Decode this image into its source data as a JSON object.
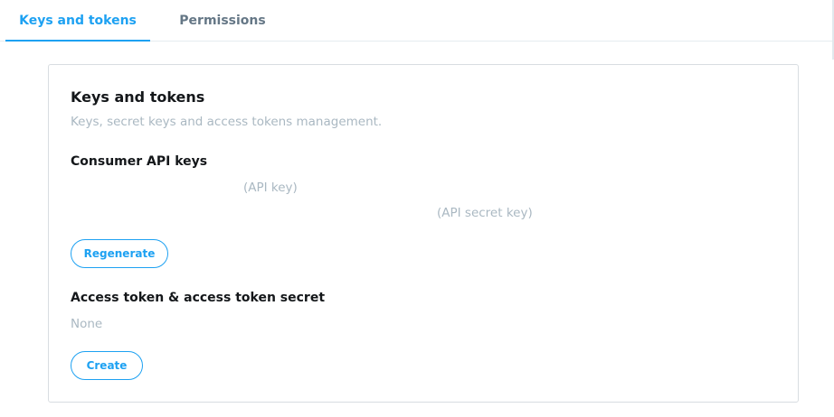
{
  "tabs": [
    {
      "label": "Keys and tokens",
      "active": true
    },
    {
      "label": "Permissions",
      "active": false
    }
  ],
  "card": {
    "title": "Keys and tokens",
    "subtitle": "Keys, secret keys and access tokens management."
  },
  "consumer_keys": {
    "title": "Consumer API keys",
    "api_key_label": "(API key)",
    "api_secret_label": "(API secret key)",
    "regenerate_label": "Regenerate"
  },
  "access_token": {
    "title": "Access token & access token secret",
    "value": "None",
    "create_label": "Create"
  },
  "colors": {
    "accent": "#1da1f2",
    "muted_text": "#aab8c2",
    "inactive_tab": "#657786",
    "border": "#d8dde1"
  }
}
